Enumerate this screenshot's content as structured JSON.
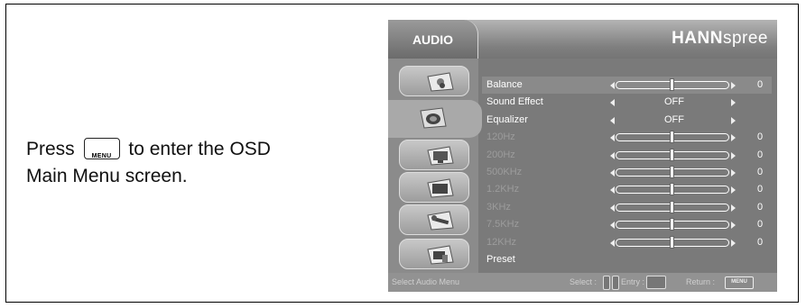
{
  "instruction": {
    "press": "Press",
    "key_label": "MENU",
    "after_key": "to enter the OSD",
    "line2": "Main Menu screen."
  },
  "osd": {
    "tab_title": "AUDIO",
    "brand_bold": "HANN",
    "brand_light": "spree",
    "icons": [
      "picture-icon",
      "audio-icon",
      "display-icon",
      "pip-icon",
      "tools-icon",
      "input-icon"
    ],
    "active_icon": "audio-icon",
    "rows": [
      {
        "label": "Balance",
        "type": "slider",
        "value": 0,
        "level": 0.5,
        "highlight": true,
        "dim": false
      },
      {
        "label": "Sound Effect",
        "type": "option",
        "value": "OFF",
        "highlight": false,
        "dim": false
      },
      {
        "label": "Equalizer",
        "type": "option",
        "value": "OFF",
        "highlight": false,
        "dim": false
      },
      {
        "label": "120Hz",
        "type": "slider",
        "value": 0,
        "level": 0.5,
        "highlight": false,
        "dim": true
      },
      {
        "label": "200Hz",
        "type": "slider",
        "value": 0,
        "level": 0.5,
        "highlight": false,
        "dim": true
      },
      {
        "label": "500KHz",
        "type": "slider",
        "value": 0,
        "level": 0.5,
        "highlight": false,
        "dim": true
      },
      {
        "label": "1.2KHz",
        "type": "slider",
        "value": 0,
        "level": 0.5,
        "highlight": false,
        "dim": true
      },
      {
        "label": "3KHz",
        "type": "slider",
        "value": 0,
        "level": 0.5,
        "highlight": false,
        "dim": true
      },
      {
        "label": "7.5KHz",
        "type": "slider",
        "value": 0,
        "level": 0.5,
        "highlight": false,
        "dim": true
      },
      {
        "label": "12KHz",
        "type": "slider",
        "value": 0,
        "level": 0.5,
        "highlight": false,
        "dim": true
      },
      {
        "label": "Preset",
        "type": "label",
        "highlight": false,
        "dim": false
      }
    ],
    "footer": {
      "hint": "Select Audio Menu",
      "select": "Select :",
      "entry": "Entry :",
      "return": "Return :",
      "menu_key": "MENU"
    }
  }
}
